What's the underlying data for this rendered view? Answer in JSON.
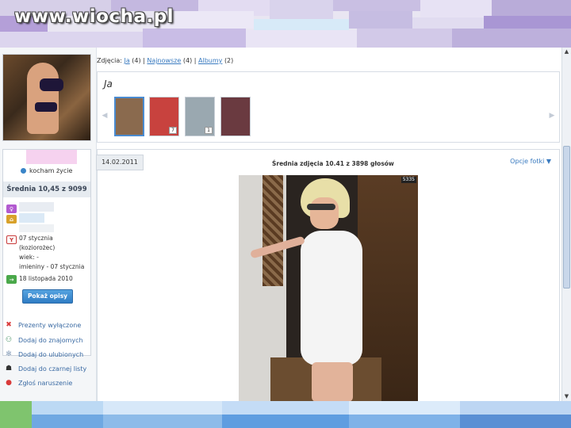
{
  "watermark": "www.wiocha.pl",
  "profile": {
    "status": "kocham życie",
    "average": "Średnia 10,45 z 9099",
    "birthday": "07 stycznia",
    "zodiac": "(koziorożec)",
    "age": "wiek: -",
    "nameday": "imieniny - 07 stycznia",
    "joined": "18 listopada 2010",
    "show_descriptions": "Pokaż opisy"
  },
  "actions": [
    {
      "label": "Prezenty wyłączone",
      "icon": "x-icon",
      "color": "#d93a3a"
    },
    {
      "label": "Dodaj do znajomych",
      "icon": "add-friend-icon",
      "color": "#3a8a5a"
    },
    {
      "label": "Dodaj do ulubionych",
      "icon": "star-icon",
      "color": "#8aa0bb"
    },
    {
      "label": "Dodaj do czarnej listy",
      "icon": "blacklist-icon",
      "color": "#333333"
    },
    {
      "label": "Zgłoś naruszenie",
      "icon": "warning-icon",
      "color": "#d93a3a"
    }
  ],
  "breadcrumb": {
    "prefix": "Zdjęcia:",
    "me": "Ja",
    "me_count": "(4)",
    "newest": "Najnowsze",
    "newest_count": "(4)",
    "albums": "Albumy",
    "albums_count": "(2)",
    "sep": "|"
  },
  "gallery": {
    "title": "Ja",
    "thumbs": [
      {
        "counter": "",
        "color": "#8a6a4e"
      },
      {
        "counter": "7",
        "color": "#c8423e"
      },
      {
        "counter": "1",
        "color": "#9aa8b0"
      },
      {
        "counter": "",
        "color": "#6a3a40"
      }
    ]
  },
  "photo": {
    "date": "14.02.2011",
    "average_text": "Średnia zdjęcia 10.41 z 3898 głosów",
    "options": "Opcje fotki ▼",
    "badge": "5335"
  },
  "colors": {
    "accent": "#3a7bc0",
    "button": "#2f7cc4"
  }
}
